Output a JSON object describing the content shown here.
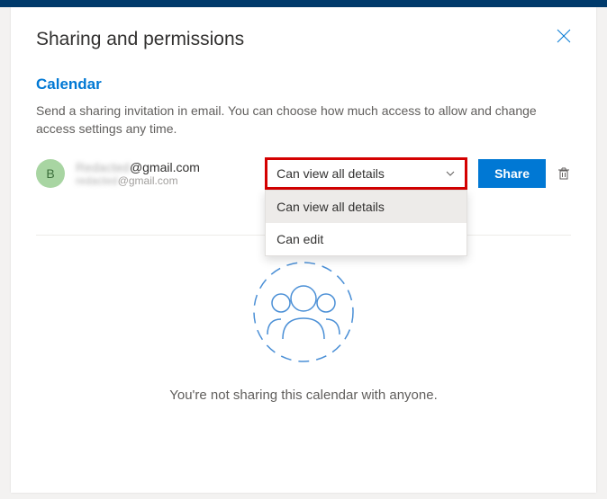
{
  "title": "Sharing and permissions",
  "subtitle": "Calendar",
  "description": "Send a sharing invitation in email. You can choose how much access to allow and change access settings any time.",
  "user": {
    "initial": "B",
    "primary_hidden": "Redacted",
    "primary_suffix": "@gmail.com",
    "secondary_hidden": "redacted",
    "secondary_suffix": "@gmail.com"
  },
  "permission": {
    "selected": "Can view all details",
    "options": [
      "Can view all details",
      "Can edit"
    ]
  },
  "share_label": "Share",
  "empty_message": "You're not sharing this calendar with anyone."
}
